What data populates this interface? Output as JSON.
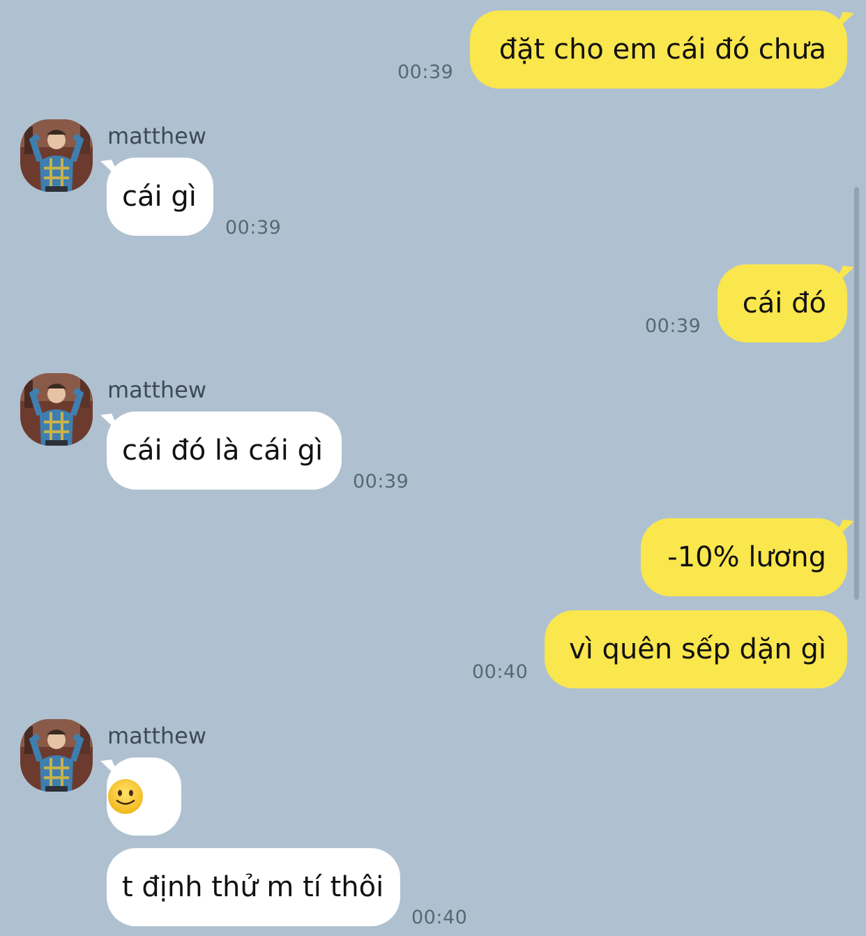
{
  "chat": {
    "contact_name": "matthew",
    "accent_color": "#fae64d",
    "background_color": "#afc1d0",
    "messages": [
      {
        "direction": "outgoing",
        "text": "đặt cho em cái đó chưa",
        "time": "00:39"
      },
      {
        "direction": "incoming",
        "sender": "matthew",
        "text": "cái gì",
        "time": "00:39"
      },
      {
        "direction": "outgoing",
        "text": "cái đó",
        "time": "00:39"
      },
      {
        "direction": "incoming",
        "sender": "matthew",
        "text": "cái đó là cái gì",
        "time": "00:39"
      },
      {
        "direction": "outgoing",
        "text": "-10% lương",
        "time": ""
      },
      {
        "direction": "outgoing",
        "text": "vì quên sếp dặn gì",
        "time": "00:40"
      },
      {
        "direction": "incoming",
        "sender": "matthew",
        "emoji": "slightly-smiling-face",
        "time": ""
      },
      {
        "direction": "incoming",
        "text": "t định thử m tí thôi",
        "time": "00:40"
      }
    ]
  }
}
